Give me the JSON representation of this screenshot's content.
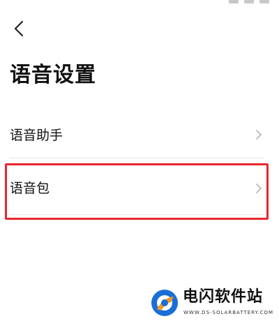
{
  "header": {
    "back_icon": "chevron-left-icon",
    "title": "语音设置"
  },
  "settings": {
    "items": [
      {
        "label": "语音助手",
        "icon": "chevron-right-icon"
      },
      {
        "label": "语音包",
        "icon": "chevron-right-icon",
        "highlighted": true
      }
    ]
  },
  "watermark": {
    "brand": "电闪软件站",
    "url": "WWW.DS-SOLARBATTERY.COM"
  },
  "colors": {
    "background": "#ffffff",
    "text": "#111111",
    "chevron": "#b5b5b5",
    "divider": "#e5e5e5",
    "highlight": "#e8262f",
    "logo_blue": "#1a6fd6",
    "logo_orange": "#f39a1e"
  }
}
